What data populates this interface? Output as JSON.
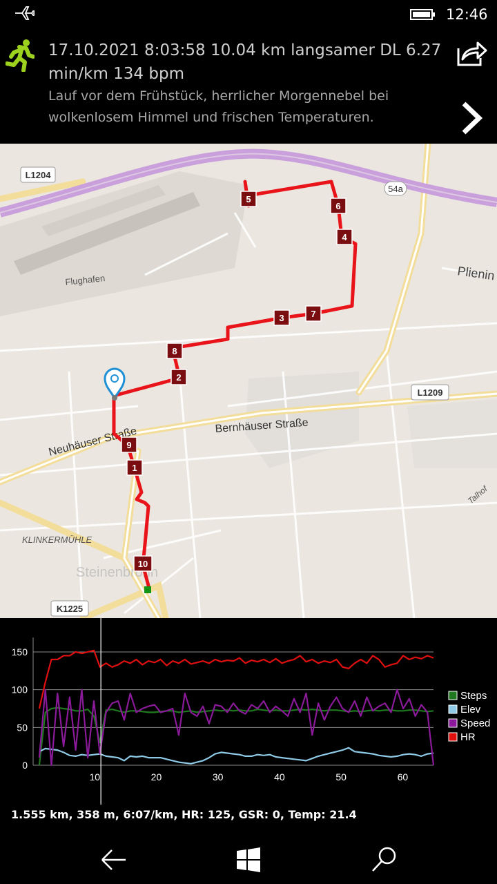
{
  "status_bar": {
    "airplane_icon": "airplane-icon",
    "battery_icon": "battery-icon",
    "time": "12:46"
  },
  "header": {
    "activity_icon": "runner-icon",
    "title": "17.10.2021 8:03:58 10.04 km langsamer DL 6.27 min/km 134 bpm",
    "description": "Lauf vor dem Frühstück, herrlicher Morgennebel bei wolkenlosem Himmel und frischen Temperaturen.",
    "share_icon": "share-icon",
    "next_icon": "chevron-right-icon"
  },
  "map": {
    "road_labels": [
      "L1204",
      "54a",
      "L1209",
      "K1225"
    ],
    "place_labels": [
      "Flughafen",
      "Plienin",
      "Bernhäuser Straße",
      "Neuhäuser Straße",
      "KLINKERMÜHLE",
      "Talhof",
      "Steinenbronn"
    ],
    "km_markers": [
      "1",
      "2",
      "3",
      "4",
      "5",
      "6",
      "7",
      "8",
      "9",
      "10"
    ],
    "route_color": "#e8141a",
    "marker_color": "#7a0d10",
    "pin_color": "#1e90d6",
    "finish_color": "#149414"
  },
  "chart_data": {
    "type": "line",
    "x_ticks": [
      "10",
      "20",
      "30",
      "40",
      "50",
      "60"
    ],
    "y_ticks": [
      "0",
      "50",
      "100",
      "150"
    ],
    "xlim": [
      0,
      65
    ],
    "ylim": [
      0,
      160
    ],
    "grid": true,
    "legend_position": "right",
    "cursor_x": 11,
    "series": [
      {
        "name": "Steps",
        "color": "#1f7a1f",
        "values": [
          0,
          70,
          75,
          76,
          75,
          74,
          72,
          72,
          74,
          65,
          30,
          73,
          74,
          72,
          70,
          72,
          72,
          71,
          70,
          70,
          71,
          72,
          72,
          70,
          71,
          72,
          70,
          71,
          72,
          73,
          72,
          73,
          72,
          73,
          72,
          72,
          74,
          73,
          72,
          73,
          72,
          72,
          73,
          74,
          73,
          74,
          73,
          72,
          73,
          73,
          72,
          71,
          72,
          71,
          72,
          73,
          72,
          73,
          73,
          72,
          72,
          73,
          73,
          72,
          71,
          72
        ]
      },
      {
        "name": "Elev",
        "color": "#8ecae6",
        "values": [
          18,
          22,
          21,
          20,
          17,
          13,
          12,
          14,
          13,
          14,
          15,
          12,
          11,
          10,
          6,
          12,
          11,
          12,
          10,
          10,
          10,
          8,
          6,
          4,
          3,
          2,
          4,
          6,
          10,
          15,
          17,
          16,
          15,
          14,
          12,
          12,
          14,
          13,
          14,
          11,
          10,
          9,
          8,
          7,
          6,
          9,
          12,
          14,
          16,
          18,
          20,
          23,
          18,
          17,
          16,
          15,
          13,
          12,
          11,
          12,
          14,
          15,
          14,
          12,
          15,
          16
        ]
      },
      {
        "name": "Speed",
        "color": "#8b1a9a",
        "values": [
          10,
          100,
          0,
          95,
          25,
          90,
          20,
          100,
          10,
          85,
          15,
          70,
          82,
          85,
          60,
          95,
          70,
          75,
          78,
          80,
          70,
          72,
          75,
          40,
          95,
          70,
          65,
          78,
          55,
          80,
          78,
          70,
          82,
          72,
          68,
          80,
          75,
          85,
          70,
          78,
          72,
          65,
          88,
          70,
          95,
          40,
          82,
          60,
          78,
          90,
          75,
          70,
          85,
          65,
          90,
          72,
          78,
          82,
          70,
          100,
          75,
          88,
          65,
          80,
          70,
          0
        ]
      },
      {
        "name": "HR",
        "color": "#e01010",
        "values": [
          75,
          110,
          140,
          140,
          145,
          145,
          150,
          148,
          150,
          152,
          130,
          135,
          130,
          133,
          138,
          135,
          140,
          133,
          138,
          136,
          140,
          132,
          138,
          135,
          140,
          134,
          136,
          138,
          135,
          140,
          137,
          139,
          138,
          142,
          135,
          139,
          137,
          140,
          136,
          141,
          135,
          138,
          140,
          145,
          137,
          140,
          135,
          138,
          136,
          140,
          130,
          128,
          135,
          140,
          135,
          145,
          140,
          130,
          133,
          135,
          145,
          140,
          143,
          141,
          145,
          142
        ]
      }
    ]
  },
  "footer": {
    "info": "1.555 km, 358 m, 6:07/km, HR: 125, GSR: 0, Temp: 21.4"
  },
  "navbar": {
    "back_icon": "back-arrow-icon",
    "home_icon": "windows-logo-icon",
    "search_icon": "search-icon"
  }
}
